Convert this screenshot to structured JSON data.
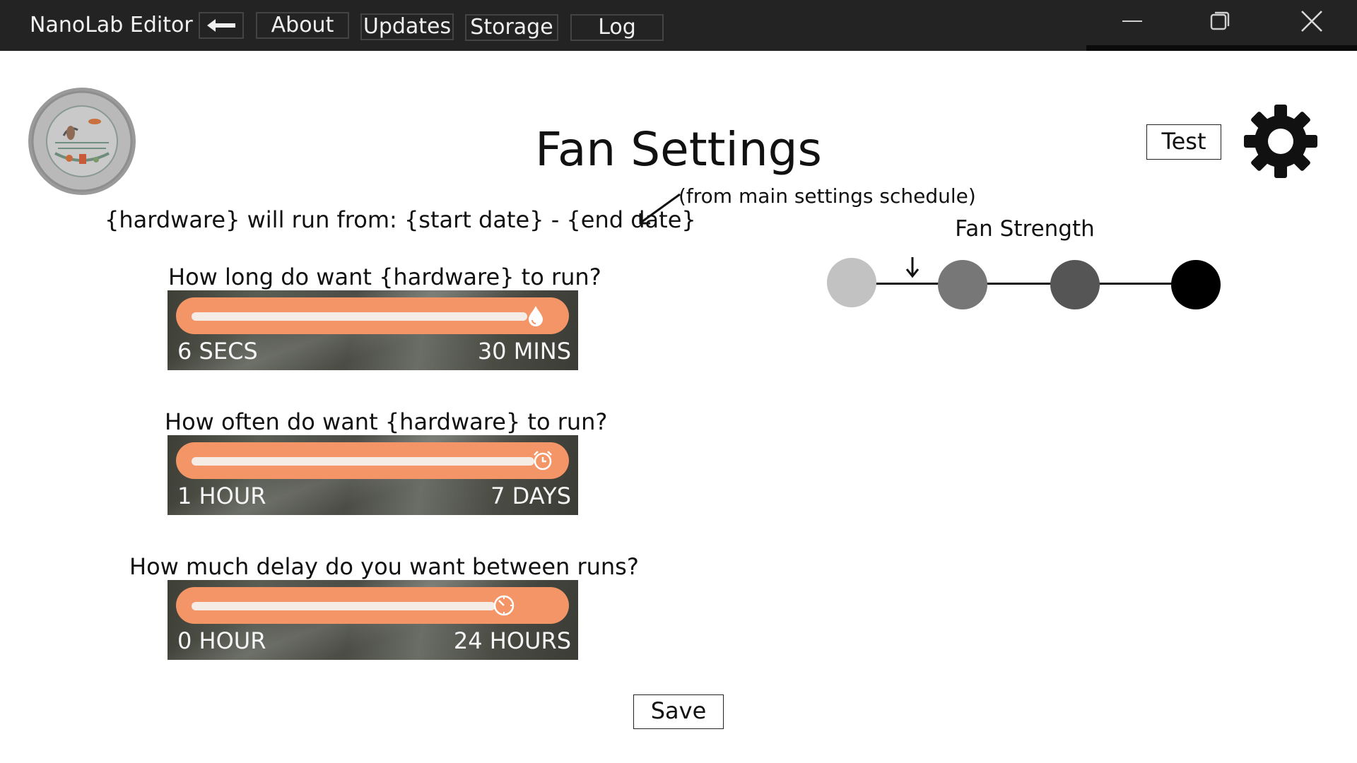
{
  "titlebar": {
    "app_title": "NanoLab Editor",
    "back_icon": "left-arrow-icon",
    "nav": [
      "About",
      "Updates",
      "Storage",
      "Log"
    ],
    "controls": [
      "minimize-icon",
      "restore-icon",
      "close-icon"
    ]
  },
  "header": {
    "logo_icon": "nanolab-seal-logo",
    "title": "Fan Settings",
    "test_label": "Test",
    "settings_icon": "gear-icon"
  },
  "schedule": {
    "text": "{hardware} will run from: {start date} - {end date}",
    "note": "(from main settings schedule)"
  },
  "sliders": [
    {
      "question": "How long do want {hardware} to run?",
      "min_label": "6 SECS",
      "max_label": "30 MINS",
      "value_fraction": 0.95,
      "icon": "water-drop-icon"
    },
    {
      "question": "How often do want {hardware} to run?",
      "min_label": "1 HOUR",
      "max_label": "7 DAYS",
      "value_fraction": 0.97,
      "icon": "alarm-clock-icon"
    },
    {
      "question": "How much delay do you want between runs?",
      "min_label": "0 HOUR",
      "max_label": "24 HOURS",
      "value_fraction": 0.86,
      "icon": "timer-icon"
    }
  ],
  "fan_strength": {
    "label": "Fan Strength",
    "levels": 4,
    "selected_level": 1,
    "colors": [
      "#c2c2c2",
      "#777777",
      "#555555",
      "#000000"
    ]
  },
  "footer": {
    "save_label": "Save"
  },
  "colors": {
    "titlebar": "#232323",
    "slider_accent": "#f39566"
  }
}
